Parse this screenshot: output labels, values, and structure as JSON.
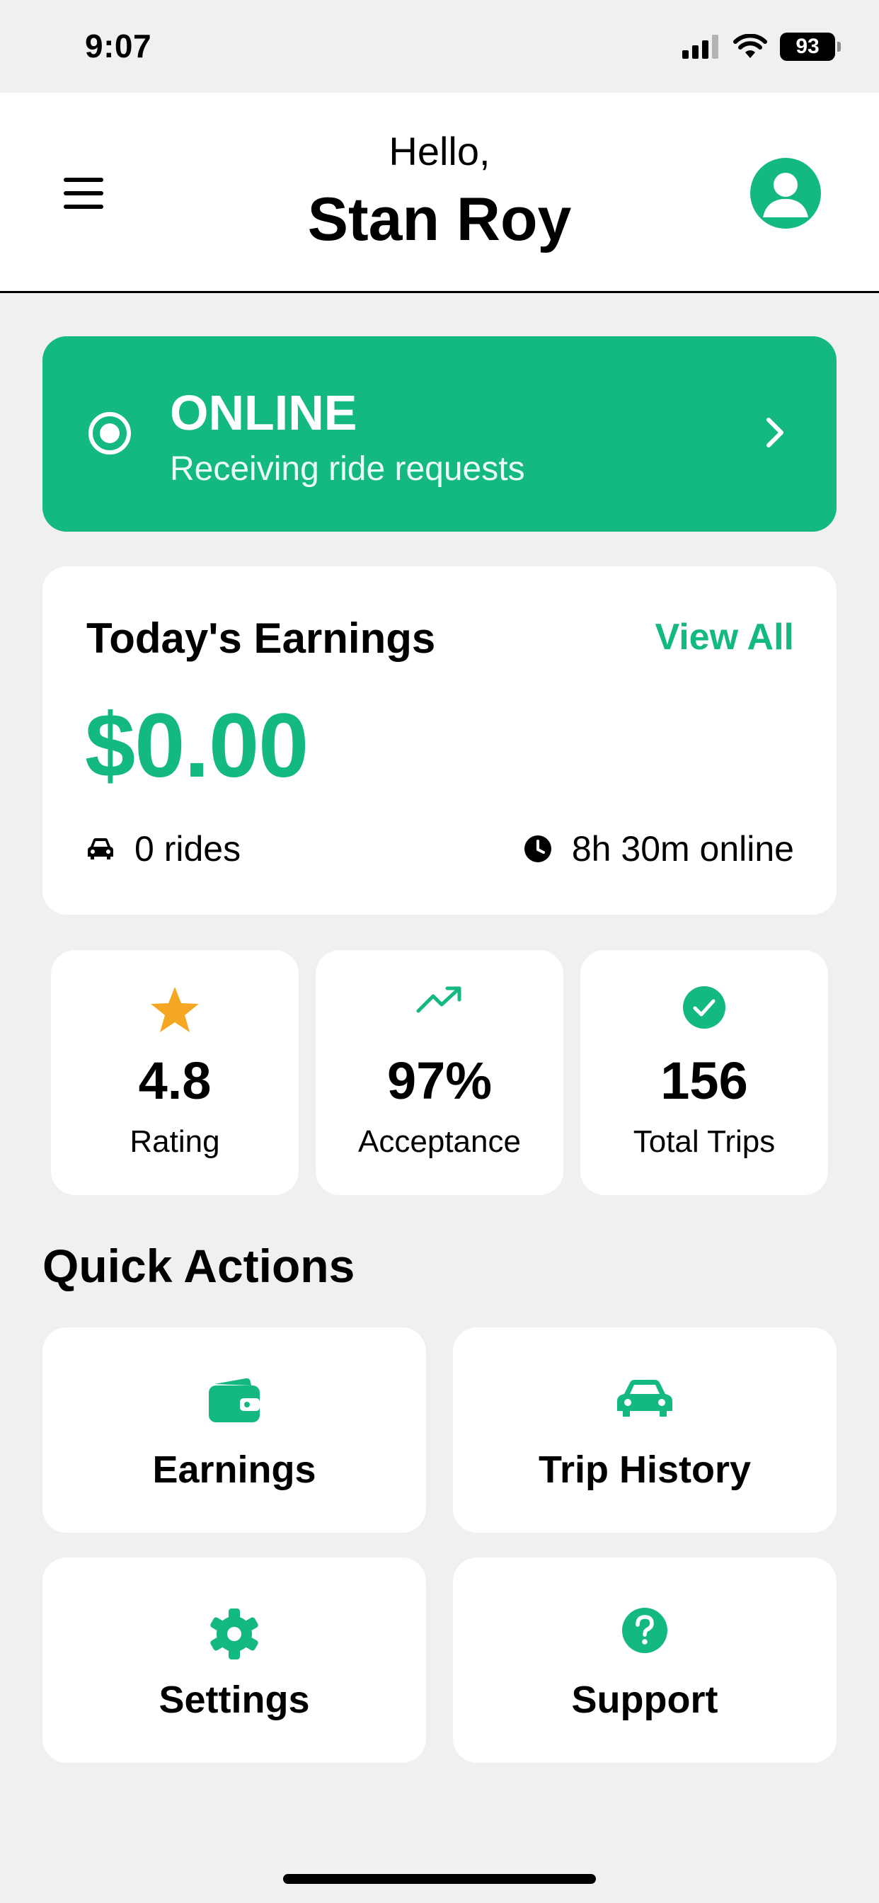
{
  "status_bar": {
    "time": "9:07",
    "battery": "93"
  },
  "header": {
    "greeting": "Hello,",
    "name": "Stan Roy"
  },
  "online_card": {
    "title": "ONLINE",
    "subtitle": "Receiving ride requests"
  },
  "earnings": {
    "title": "Today's Earnings",
    "view_all": "View All",
    "amount": "$0.00",
    "rides": "0 rides",
    "online_time": "8h 30m online"
  },
  "stats": [
    {
      "value": "4.8",
      "label": "Rating",
      "icon": "star-icon"
    },
    {
      "value": "97%",
      "label": "Acceptance",
      "icon": "trending-up-icon"
    },
    {
      "value": "156",
      "label": "Total Trips",
      "icon": "check-circle-icon"
    }
  ],
  "quick_actions": {
    "title": "Quick Actions",
    "items": [
      {
        "label": "Earnings",
        "icon": "wallet-icon"
      },
      {
        "label": "Trip History",
        "icon": "car-icon"
      },
      {
        "label": "Settings",
        "icon": "gear-icon"
      },
      {
        "label": "Support",
        "icon": "help-icon"
      }
    ]
  },
  "colors": {
    "accent": "#13b981",
    "star": "#f5a623",
    "background": "#f0f0f0"
  }
}
